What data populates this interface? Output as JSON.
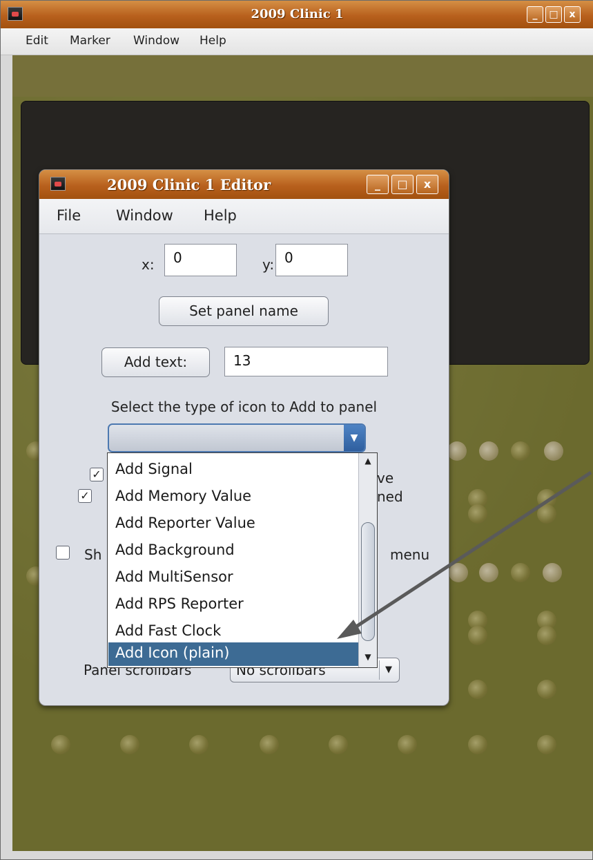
{
  "main_window": {
    "title": "2009 Clinic 1",
    "menu": [
      "Edit",
      "Marker",
      "Window",
      "Help"
    ],
    "controls": {
      "minimize": "_",
      "maximize": "□",
      "close": "x"
    }
  },
  "editor": {
    "title": "2009 Clinic 1 Editor",
    "menu": [
      "File",
      "Window",
      "Help"
    ],
    "controls": {
      "minimize": "_",
      "maximize": "□",
      "close": "x"
    },
    "x_label": "x:",
    "x_value": "0",
    "y_label": "y:",
    "y_value": "0",
    "set_panel_name_label": "Set panel name",
    "add_text_label": "Add text:",
    "add_text_value": "13",
    "select_icon_prompt": "Select the type of icon to Add to panel",
    "icon_type_value": "",
    "partial_labels": {
      "checkbox1_tail": "ve",
      "checkbox2_tail": "ned",
      "checkbox3_head": "Sh",
      "checkbox3_tail": "menu"
    },
    "checkbox_states": [
      true,
      true,
      false
    ],
    "panel_scrollbars_label": "Panel scrollbars",
    "panel_scrollbars_value": "No scrollbars"
  },
  "dropdown": {
    "items": [
      "Add Signal",
      "Add Memory Value",
      "Add Reporter Value",
      "Add Background",
      "Add MultiSensor",
      "Add RPS Reporter",
      "Add Fast Clock",
      "Add Icon (plain)"
    ],
    "selected_index": 7,
    "scroll_up": "▲",
    "scroll_down": "▼"
  },
  "icons": {
    "app": "train-app-icon",
    "combo_arrow": "▼",
    "check": "✓"
  }
}
